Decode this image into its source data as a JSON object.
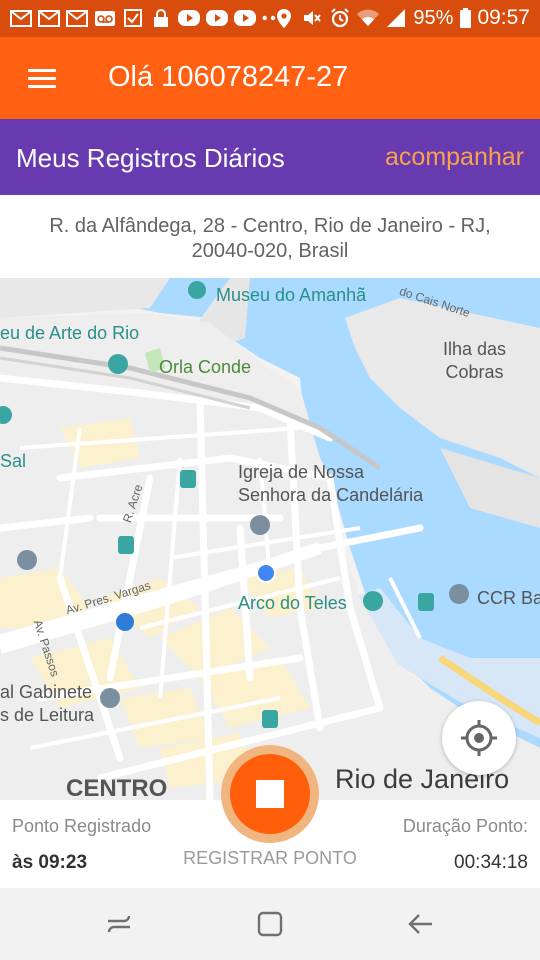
{
  "status_bar": {
    "left_icons": [
      "gmail-icon",
      "gmail-icon",
      "gmail-icon",
      "voicemail-icon",
      "task-check-icon",
      "lock-icon",
      "youtube-icon",
      "youtube-icon",
      "youtube-icon",
      "more-dots-icon"
    ],
    "right_icons": [
      "location-icon",
      "mute-icon",
      "alarm-icon",
      "wifi-icon",
      "signal-icon",
      "battery-icon"
    ],
    "battery": "95%",
    "time": "09:57"
  },
  "header": {
    "menu_icon": "hamburger-menu-icon",
    "greeting": "Olá 106078247-27"
  },
  "subheader": {
    "title": "Meus Registros Diários",
    "action": "acompanhar"
  },
  "address": {
    "line1": "R. da Alfândega, 28 - Centro, Rio de Janeiro - RJ,",
    "line2": "20040-020, Brasil"
  },
  "map": {
    "labels": {
      "museu_amanha": "Museu do Amanhã",
      "cais_norte": "do Cais Norte",
      "museu_arte": "eu de Arte do Rio",
      "ilha_line1": "Ilha das",
      "ilha_line2": "Cobras",
      "orla_conde": "Orla Conde",
      "sal": "Sal",
      "igreja_line1": "Igreja de Nossa",
      "igreja_line2": "Senhora da Candelária",
      "r_acre": "R. Acre",
      "av_vargas": "Av. Pres. Vargas",
      "av_passos": "Av. Passos",
      "arco_teles": "Arco do Teles",
      "ccr": "CCR Ba",
      "gabinete_line1": "al Gabinete",
      "gabinete_line2": "s de Leitura",
      "centro": "CENTRO",
      "rio": "Rio de Janeiro"
    },
    "locate_icon": "my-location-icon"
  },
  "panel": {
    "registered_label": "Ponto Registrado",
    "registered_time": "às 09:23",
    "button_label": "REGISTRAR PONTO",
    "stop_icon": "stop-icon",
    "duration_label": "Duração Ponto:",
    "duration_value": "00:34:18"
  },
  "navbar": {
    "icons": [
      "recent-apps-icon",
      "home-icon",
      "back-icon"
    ]
  },
  "colors": {
    "status_bar": "#d84d0e",
    "app_bar": "#ff6011",
    "subheader": "#673ab0",
    "accent_link": "#f8a24c",
    "fab": "#ff5e0a",
    "water": "#aadaff"
  }
}
